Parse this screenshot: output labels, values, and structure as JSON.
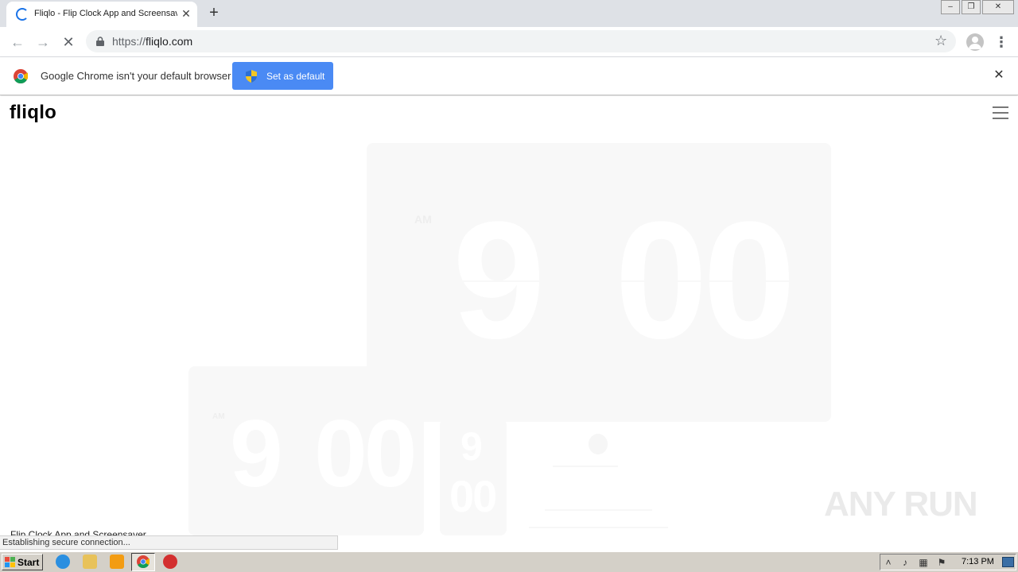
{
  "browser": {
    "tab_title": "Fliqlo - Flip Clock App and Screensaver",
    "tab_close": "✕",
    "new_tab": "+",
    "window_controls": {
      "minimize": "–",
      "restore": "❐",
      "close": "✕"
    },
    "nav": {
      "back": "←",
      "forward": "→",
      "stop": "✕"
    },
    "url_scheme": "https://",
    "url_host": "fliqlo.com",
    "star": "☆",
    "menu": "⋮"
  },
  "infobar": {
    "message": "Google Chrome isn't your default browser",
    "button_label": "Set as default",
    "close": "✕"
  },
  "page": {
    "logo": "fliqlo",
    "clock_large": {
      "ampm": "AM",
      "hour": "9",
      "minutes": "00"
    },
    "clock_medium": {
      "ampm": "AM",
      "hour": "9",
      "minutes": "00"
    },
    "clock_small": {
      "hour": "9",
      "minutes": "00"
    },
    "caption": "Flip Clock App and Screensaver"
  },
  "status_bubble": "Establishing secure connection...",
  "watermark": "ANY RUN",
  "taskbar": {
    "start_label": "Start",
    "clock": "7:13 PM",
    "tray_expand": "˄"
  },
  "colors": {
    "chrome_blue": "#4a8af4",
    "tabstrip": "#dee1e6",
    "panel": "#f8f8f8",
    "taskbar": "#d4d0c8"
  }
}
